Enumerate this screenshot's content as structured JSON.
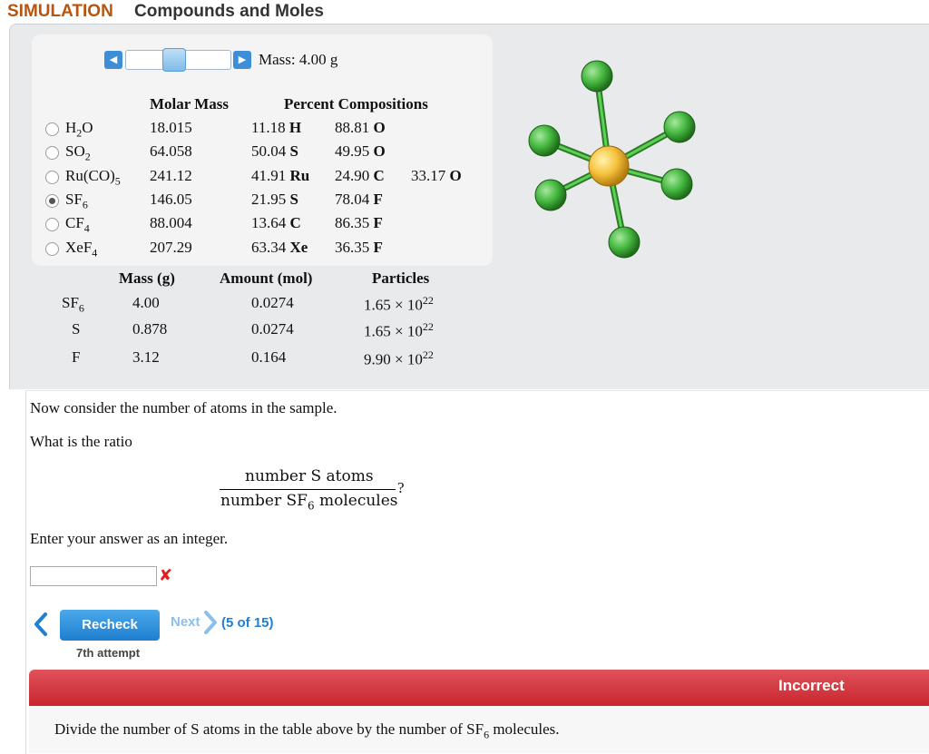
{
  "header": {
    "sim_label": "SIMULATION",
    "title": "Compounds and Moles"
  },
  "slider": {
    "mass_label": "Mass: 4.00 g",
    "position": 0.45
  },
  "compound_table": {
    "col_molar": "Molar Mass",
    "col_percent": "Percent Compositions",
    "rows": [
      {
        "formula": "H",
        "sub": "2",
        "tail": "O",
        "molar": "18.015",
        "p1": "11.18",
        "e1": "H",
        "p2": "88.81",
        "e2": "O",
        "p3": "",
        "e3": "",
        "selected": false
      },
      {
        "formula": "SO",
        "sub": "2",
        "tail": "",
        "molar": "64.058",
        "p1": "50.04",
        "e1": "S",
        "p2": "49.95",
        "e2": "O",
        "p3": "",
        "e3": "",
        "selected": false
      },
      {
        "formula": "Ru(CO)",
        "sub": "5",
        "tail": "",
        "molar": "241.12",
        "p1": "41.91",
        "e1": "Ru",
        "p2": "24.90",
        "e2": "C",
        "p3": "33.17",
        "e3": "O",
        "selected": false
      },
      {
        "formula": "SF",
        "sub": "6",
        "tail": "",
        "molar": "146.05",
        "p1": "21.95",
        "e1": "S",
        "p2": "78.04",
        "e2": "F",
        "p3": "",
        "e3": "",
        "selected": true
      },
      {
        "formula": "CF",
        "sub": "4",
        "tail": "",
        "molar": "88.004",
        "p1": "13.64",
        "e1": "C",
        "p2": "86.35",
        "e2": "F",
        "p3": "",
        "e3": "",
        "selected": false
      },
      {
        "formula": "XeF",
        "sub": "4",
        "tail": "",
        "molar": "207.29",
        "p1": "63.34",
        "e1": "Xe",
        "p2": "36.35",
        "e2": "F",
        "p3": "",
        "e3": "",
        "selected": false
      }
    ]
  },
  "mole_table": {
    "col_mass": "Mass (g)",
    "col_amount": "Amount (mol)",
    "col_particles": "Particles",
    "rows": [
      {
        "label": "SF",
        "sub": "6",
        "mass": "4.00",
        "amount": "0.0274",
        "particles": "1.65 × 10",
        "exp": "22"
      },
      {
        "label": "S",
        "sub": "",
        "mass": "0.878",
        "amount": "0.0274",
        "particles": "1.65 × 10",
        "exp": "22"
      },
      {
        "label": "F",
        "sub": "",
        "mass": "3.12",
        "amount": "0.164",
        "particles": "9.90 × 10",
        "exp": "22"
      }
    ]
  },
  "question": {
    "intro": "Now consider the number of atoms in the sample.",
    "prompt": "What is the ratio",
    "numerator": "number S atoms",
    "denominator_pre": "number SF",
    "denominator_sub": "6",
    "denominator_post": " molecules",
    "qmark": "?",
    "instruction": "Enter your answer as an integer.",
    "answer_value": ""
  },
  "nav": {
    "recheck_label": "Recheck",
    "next_label": "Next",
    "page_count": "(5 of 15)",
    "attempt_text": "7th attempt"
  },
  "feedback": {
    "status": "Incorrect",
    "text_pre": "Divide the number of S atoms in the table above by the number of SF",
    "text_sub": "6",
    "text_post": " molecules."
  },
  "colors": {
    "accent": "#1f7fd0",
    "sim_label": "#b8540b",
    "incorrect": "#c8262e",
    "central_atom": "#f6c23c",
    "fluorine": "#45b83f"
  },
  "icons": {
    "slider_left": "triangle-left-icon",
    "slider_right": "triangle-right-icon",
    "error": "x-mark-icon",
    "back": "chevron-left-icon",
    "next": "chevron-right-icon"
  }
}
